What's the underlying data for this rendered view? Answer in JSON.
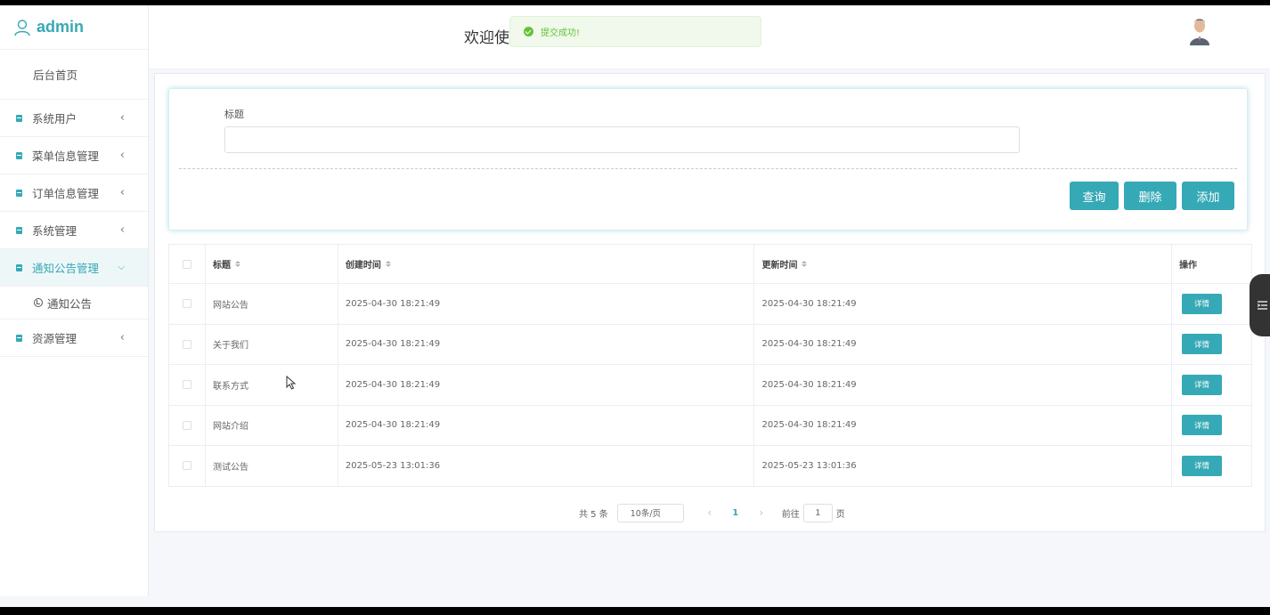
{
  "brand": {
    "username": "admin"
  },
  "sidebar": {
    "home": "后台首页",
    "items": [
      {
        "label": "系统用户",
        "expanded": false
      },
      {
        "label": "菜单信息管理",
        "expanded": false
      },
      {
        "label": "订单信息管理",
        "expanded": false
      },
      {
        "label": "系统管理",
        "expanded": false
      },
      {
        "label": "通知公告管理",
        "expanded": true
      },
      {
        "label": "资源管理",
        "expanded": false
      }
    ],
    "submenu": {
      "label": "通知公告"
    }
  },
  "header": {
    "welcome": "欢迎使"
  },
  "toast": {
    "message": "提交成功!",
    "color": "#67c23a"
  },
  "search": {
    "label": "标题",
    "value": "",
    "placeholder": "",
    "query_label": "查询",
    "delete_label": "删除",
    "add_label": "添加"
  },
  "table": {
    "columns": [
      "标题",
      "创建时间",
      "更新时间",
      "操作"
    ],
    "detail_label": "详情",
    "rows": [
      {
        "title": "网站公告",
        "created": "2025-04-30 18:21:49",
        "updated": "2025-04-30 18:21:49"
      },
      {
        "title": "关于我们",
        "created": "2025-04-30 18:21:49",
        "updated": "2025-04-30 18:21:49"
      },
      {
        "title": "联系方式",
        "created": "2025-04-30 18:21:49",
        "updated": "2025-04-30 18:21:49"
      },
      {
        "title": "网站介绍",
        "created": "2025-04-30 18:21:49",
        "updated": "2025-04-30 18:21:49"
      },
      {
        "title": "测试公告",
        "created": "2025-05-23 13:01:36",
        "updated": "2025-05-23 13:01:36"
      }
    ]
  },
  "pagination": {
    "total": "共 5 条",
    "page_size": "10条/页",
    "current": "1",
    "goto_prefix": "前往",
    "goto_value": "1",
    "goto_suffix": "页"
  },
  "theme": {
    "accent": "#36a9b6"
  },
  "icons": [
    "user-icon",
    "document-icon",
    "chevron-left-icon",
    "chevron-down-icon",
    "clock-icon",
    "success-icon",
    "sort-icon",
    "list-toggle-icon",
    "mouse-cursor-icon"
  ]
}
